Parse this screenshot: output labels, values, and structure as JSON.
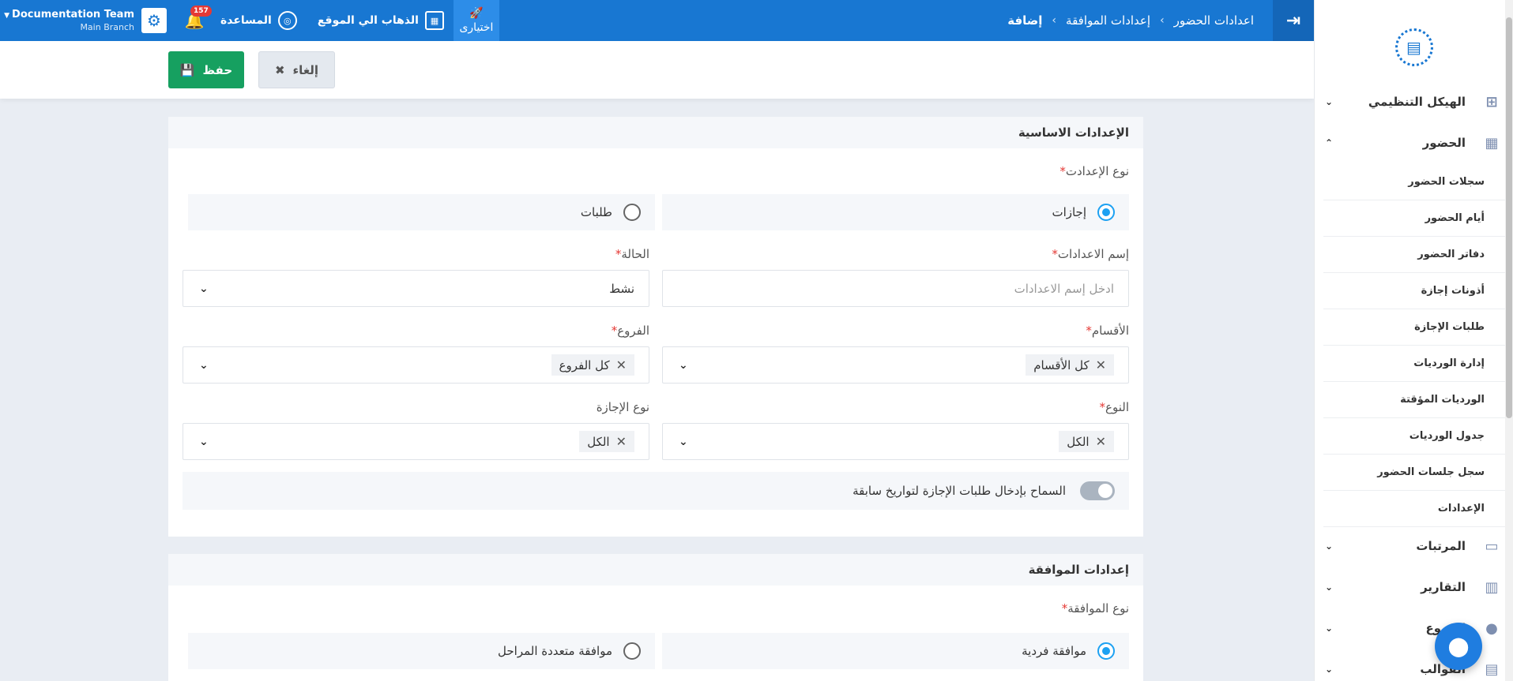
{
  "topbar": {
    "breadcrumbs": [
      "اعدادات الحضور",
      "إعدادات الموافقة",
      "إضافة"
    ],
    "team_name": "Documentation Team",
    "branch": "Main Branch",
    "notifications_count": "157",
    "help_label": "المساعدة",
    "goto_site_label": "الذهاب الي الموقع",
    "trial_label": "اختيارى",
    "color": "#1877d2"
  },
  "actions": {
    "save_label": "حفظ",
    "cancel_label": "إلغاء"
  },
  "basic": {
    "title": "الإعدادات الاساسية",
    "setting_type_label": "نوع الإعدادت",
    "option_vacations": "إجازات",
    "option_requests": "طلبات",
    "selected_type": "إجازات",
    "name_label": "إسم الاعدادات",
    "name_placeholder": "ادخل إسم الاعدادات",
    "status_label": "الحالة",
    "status_value": "نشط",
    "departments_label": "الأقسام",
    "departments_chip": "كل الأقسام",
    "branches_label": "الفروع",
    "branches_chip": "كل الفروع",
    "kind_label": "النوع",
    "kind_chip": "الكل",
    "leave_type_label": "نوع الإجازة",
    "leave_type_chip": "الكل",
    "allow_past_label": "السماح بإدخال طلبات الإجازة لتواريخ سابقة",
    "allow_past_enabled": false
  },
  "approval": {
    "title": "إعدادات الموافقة",
    "type_label": "نوع الموافقة",
    "option_single": "موافقة فردية",
    "option_multi": "موافقة متعددة المراحل",
    "selected": "موافقة فردية"
  },
  "sidebar": {
    "org_structure": "الهيكل التنظيمي",
    "attendance": "الحضور",
    "sub_items": [
      "سجلات الحضور",
      "أيام الحضور",
      "دفاتر الحضور",
      "أذونات إجازة",
      "طلبات الإجازة",
      "إدارة الورديات",
      "الورديات المؤقتة",
      "جدول الورديات",
      "سجل جلسات الحضور",
      "الإعدادات"
    ],
    "payroll": "المرتبات",
    "reports": "التقارير",
    "branches": "الفروع",
    "templates": "القوالب"
  }
}
